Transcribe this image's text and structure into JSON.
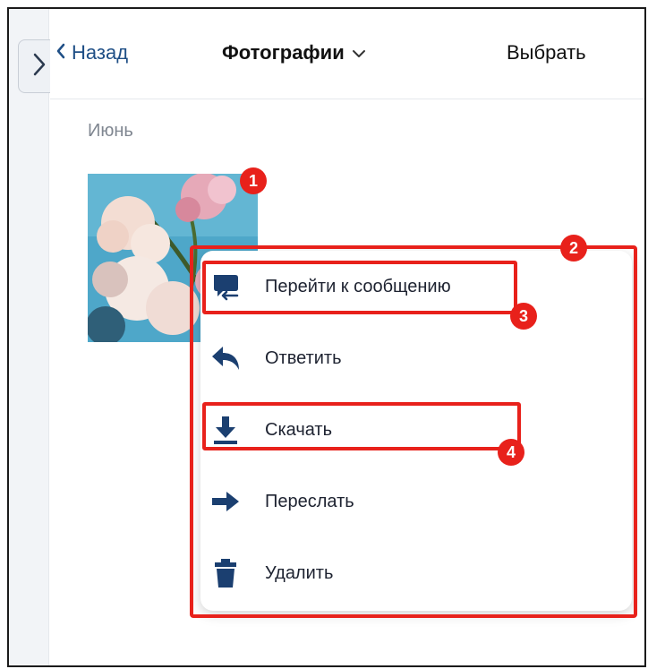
{
  "header": {
    "back_label": "Назад",
    "title": "Фотографии",
    "select_label": "Выбрать"
  },
  "section": {
    "month": "Июнь"
  },
  "annotations": {
    "badge_1": "1",
    "badge_2": "2",
    "badge_3": "3",
    "badge_4": "4"
  },
  "context_menu": {
    "items": [
      {
        "label": "Перейти к сообщению",
        "icon": "go-to-message-icon"
      },
      {
        "label": "Ответить",
        "icon": "reply-icon"
      },
      {
        "label": "Скачать",
        "icon": "download-icon"
      },
      {
        "label": "Переслать",
        "icon": "forward-icon"
      },
      {
        "label": "Удалить",
        "icon": "trash-icon"
      }
    ]
  },
  "colors": {
    "accent_blue": "#1f4f86",
    "annotation_red": "#e8211b"
  }
}
